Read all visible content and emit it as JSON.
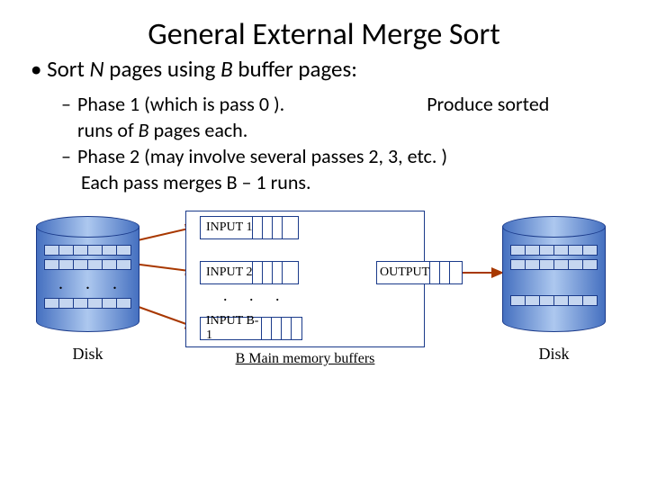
{
  "title": "General External Merge Sort",
  "bullet": "Sort N pages using B buffer pages:",
  "sub1_a": "Phase 1 (which is pass 0 ).",
  "sub1_b": "Produce sorted",
  "sub1_c": "runs of B pages each.",
  "sub2": "Phase 2  (may involve several passes 2, 3, etc. )",
  "sub_final": "Each pass  merges  B – 1  runs.",
  "diagram": {
    "input1": "INPUT 1",
    "input2": "INPUT 2",
    "inputB": "INPUT B-1",
    "output": "OUTPUT",
    "mem_label": "B Main memory buffers",
    "disk": "Disk",
    "dots": ". . ."
  }
}
